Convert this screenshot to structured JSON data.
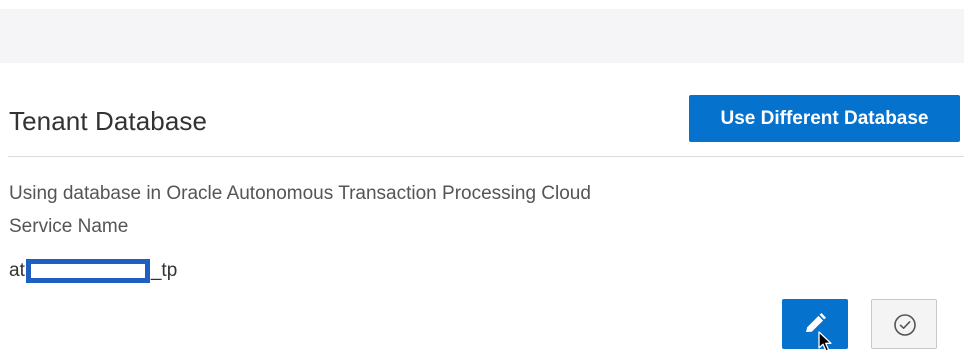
{
  "header": {
    "title": "Tenant Database",
    "action_label": "Use Different Database"
  },
  "details": {
    "description_line1": "Using database in Oracle Autonomous Transaction Processing Cloud",
    "description_line2": "Service Name",
    "service_name_prefix": "at",
    "service_name_suffix": "_tp"
  },
  "actions": {
    "edit_icon": "pencil-icon",
    "confirm_icon": "check-circle-icon"
  },
  "colors": {
    "accent": "#0572ce",
    "redaction": "#1f5fc4"
  }
}
